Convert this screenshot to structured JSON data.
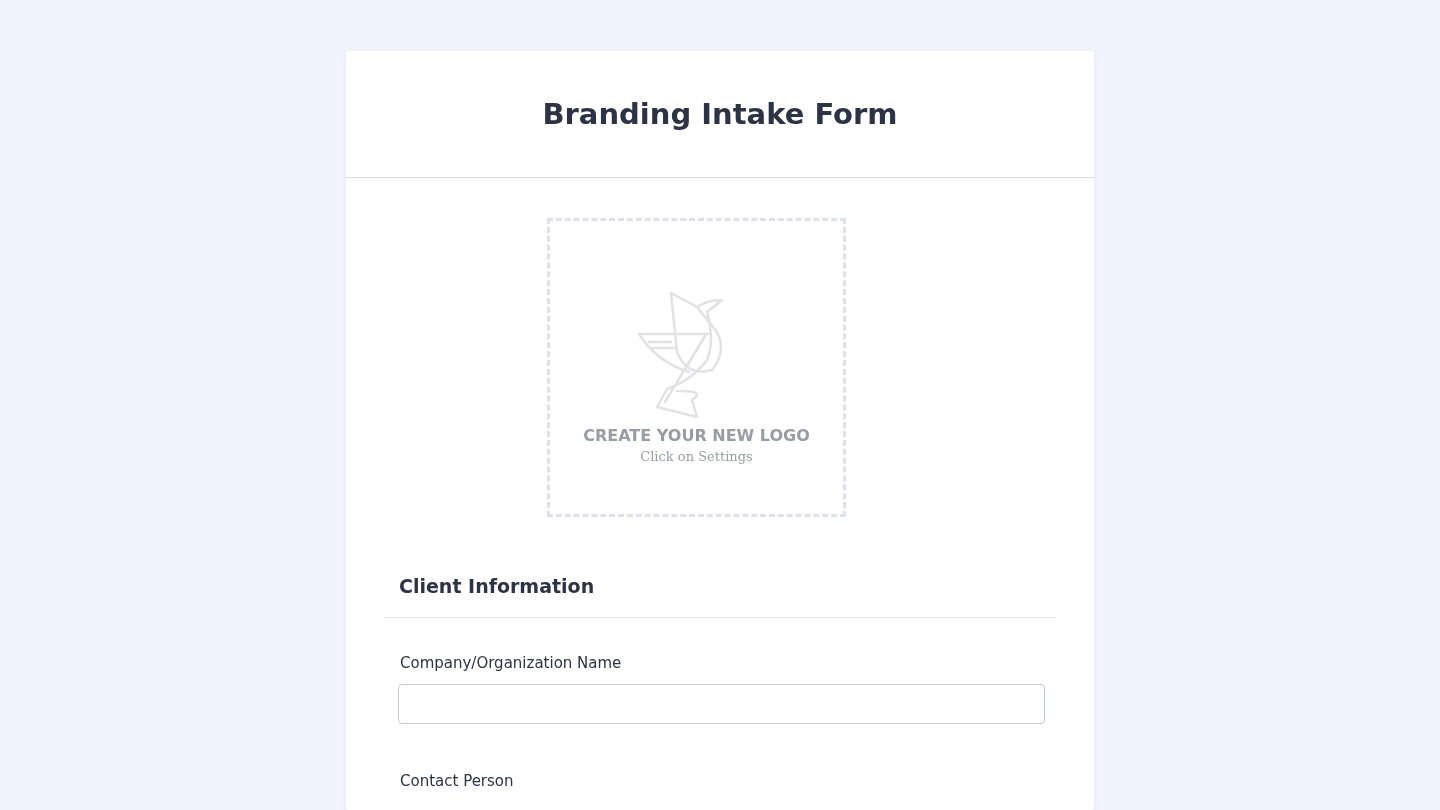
{
  "form": {
    "title": "Branding Intake Form"
  },
  "logo_placeholder": {
    "heading": "CREATE YOUR NEW LOGO",
    "hint": "Click on Settings"
  },
  "section": {
    "heading": "Client Information"
  },
  "fields": [
    {
      "label": "Company/Organization Name",
      "kind": "text"
    },
    {
      "label": "Contact Person",
      "kind": "label"
    }
  ]
}
